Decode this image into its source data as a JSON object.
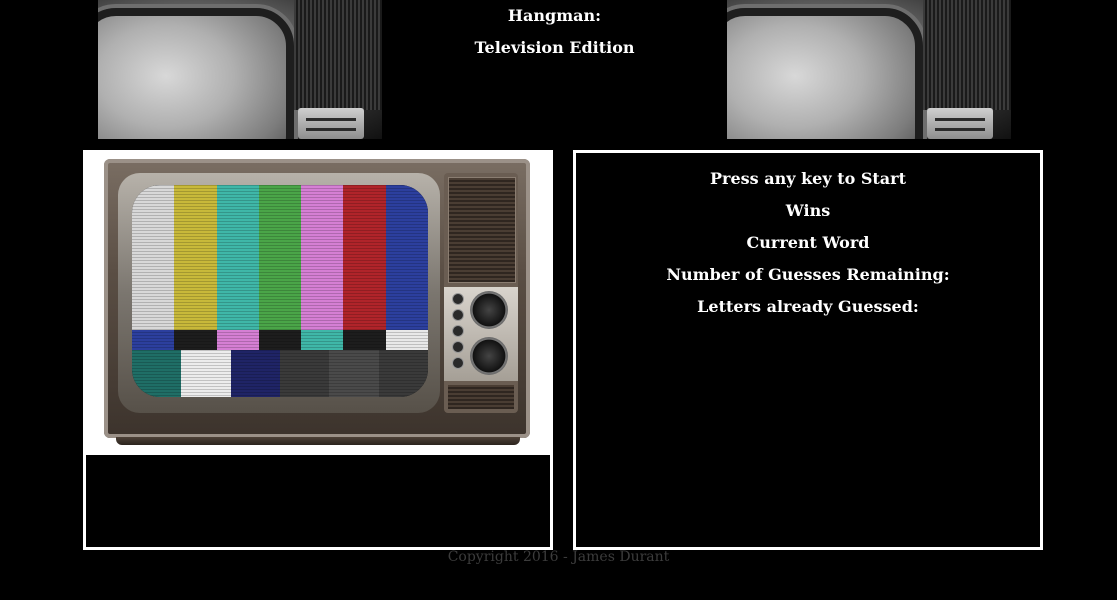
{
  "header": {
    "title_line1": "Hangman:",
    "title_line2": "Television Edition"
  },
  "game": {
    "start_prompt": "Press any key to Start",
    "wins_label": "Wins",
    "current_word_label": "Current Word",
    "guesses_remaining_label": "Number of Guesses Remaining:",
    "letters_guessed_label": "Letters already Guessed:"
  },
  "footer": {
    "copyright": "Copyright 2016 - James Durant"
  },
  "colors": {
    "background": "#000000",
    "text": "#ffffff",
    "panel_border": "#ffffff",
    "footer_text": "#3c3c3c",
    "color_bars_top": [
      "#d8d8d8",
      "#c8b93a",
      "#3fb7a8",
      "#4aa548",
      "#d57fd4",
      "#b0242a",
      "#2c3f9e"
    ],
    "color_bars_mid": [
      "#2c3f9e",
      "#1d1d1d",
      "#d57fd4",
      "#1d1d1d",
      "#3fb7a8",
      "#1d1d1d",
      "#e8e8e8"
    ],
    "color_bars_bot": [
      "#1f6e66",
      "#ececec",
      "#1f2466",
      "#3a3a3a",
      "#4a4a4a",
      "#3a3a3a"
    ]
  }
}
